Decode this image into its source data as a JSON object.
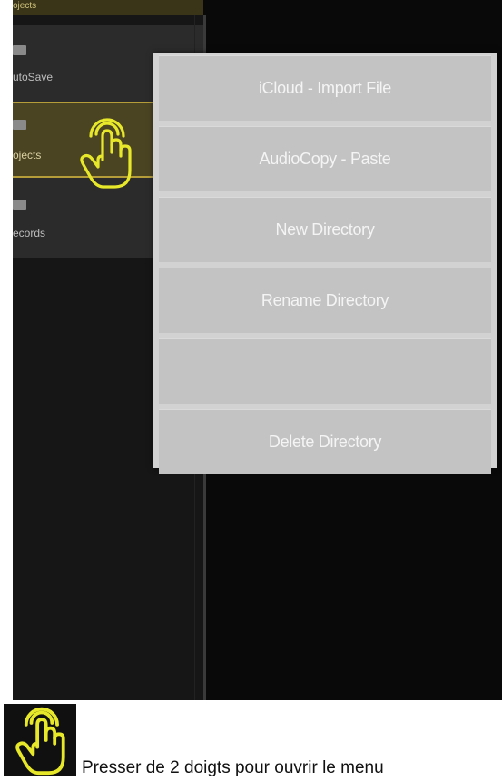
{
  "sidebar": {
    "header": "ojects",
    "items": [
      {
        "label": "utoSave",
        "icon": "folder-icon",
        "selected": false
      },
      {
        "label": "ojects",
        "icon": "folder-icon",
        "selected": true
      },
      {
        "label": "ecords",
        "icon": "folder-icon",
        "selected": false
      }
    ]
  },
  "context_menu": {
    "items": [
      {
        "label": "iCloud - Import File"
      },
      {
        "label": "AudioCopy - Paste"
      },
      {
        "label": "New Directory"
      },
      {
        "label": "Rename Directory"
      },
      {
        "label": ""
      },
      {
        "label": "Delete Directory"
      }
    ]
  },
  "annotation": {
    "gesture_icon": "two-finger-press-icon",
    "caption": "Presser de 2 doigts pour ouvrir le menu",
    "accent_color": "#e8e82a"
  },
  "colors": {
    "screen_background": "#090909",
    "selected_item_border": "#b59e3a",
    "menu_background": "#d2d2d2"
  }
}
